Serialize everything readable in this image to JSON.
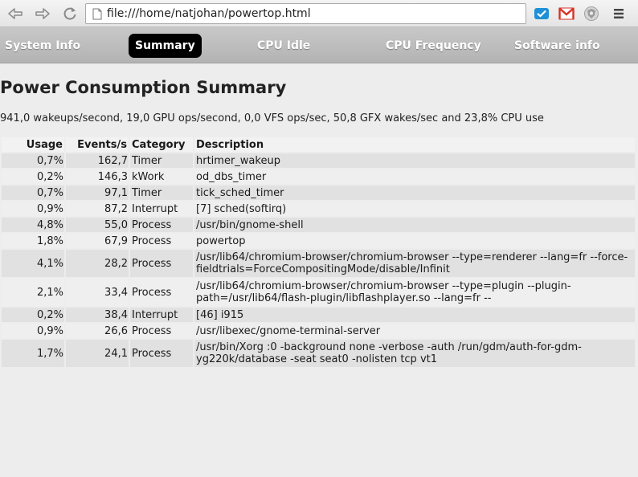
{
  "browser": {
    "url": "file:///home/natjohan/powertop.html",
    "icons": [
      "back-icon",
      "forward-icon",
      "reload-icon",
      "page-icon",
      "extension-check-icon",
      "gmail-icon",
      "extension-shield-icon",
      "menu-icon"
    ]
  },
  "tabs": [
    {
      "label": "System Info",
      "active": false
    },
    {
      "label": "Summary",
      "active": true
    },
    {
      "label": "CPU Idle",
      "active": false
    },
    {
      "label": "CPU Frequency",
      "active": false
    },
    {
      "label": "Software info",
      "active": false
    }
  ],
  "page": {
    "title": "Power Consumption Summary",
    "summary": "941,0 wakeups/second, 19,0 GPU ops/second, 0,0 VFS ops/sec, 50,8 GFX wakes/sec and 23,8% CPU use"
  },
  "table": {
    "headers": [
      "Usage",
      "Events/s",
      "Category",
      "Description"
    ],
    "rows": [
      {
        "usage": "0,7%",
        "events": "162,7",
        "category": "Timer",
        "description": "hrtimer_wakeup",
        "lines": [
          "hrtimer_wakeup"
        ]
      },
      {
        "usage": "0,2%",
        "events": "146,3",
        "category": "kWork",
        "description": "od_dbs_timer",
        "lines": [
          "od_dbs_timer"
        ]
      },
      {
        "usage": "0,7%",
        "events": "97,1",
        "category": "Timer",
        "description": "tick_sched_timer",
        "lines": [
          "tick_sched_timer"
        ]
      },
      {
        "usage": "0,9%",
        "events": "87,2",
        "category": "Interrupt",
        "description": "[7] sched(softirq)",
        "lines": [
          "[7] sched(softirq)"
        ]
      },
      {
        "usage": "4,8%",
        "events": "55,0",
        "category": "Process",
        "description": "/usr/bin/gnome-shell",
        "lines": [
          "/usr/bin/gnome-shell"
        ]
      },
      {
        "usage": "1,8%",
        "events": "67,9",
        "category": "Process",
        "description": "powertop",
        "lines": [
          "powertop"
        ]
      },
      {
        "usage": "4,1%",
        "events": "28,2",
        "category": "Process",
        "description": "/usr/lib64/chromium-browser/chromium-browser --type=renderer --lang=fr --force-fieldtrials=ForceCompositingMode/disable/Infinit",
        "lines": [
          "/usr/lib64/chromium-browser/chromium-browser --type=renderer --lang=fr --force-",
          "fieldtrials=ForceCompositingMode/disable/Infinit"
        ]
      },
      {
        "usage": "2,1%",
        "events": "33,4",
        "category": "Process",
        "description": "/usr/lib64/chromium-browser/chromium-browser --type=plugin --plugin-path=/usr/lib64/flash-plugin/libflashplayer.so --lang=fr --",
        "lines": [
          "/usr/lib64/chromium-browser/chromium-browser --type=plugin --plugin-",
          "path=/usr/lib64/flash-plugin/libflashplayer.so --lang=fr --"
        ]
      },
      {
        "usage": "0,2%",
        "events": "38,4",
        "category": "Interrupt",
        "description": "[46] i915",
        "lines": [
          "[46] i915"
        ]
      },
      {
        "usage": "0,9%",
        "events": "26,6",
        "category": "Process",
        "description": "/usr/libexec/gnome-terminal-server",
        "lines": [
          "/usr/libexec/gnome-terminal-server"
        ]
      },
      {
        "usage": "1,7%",
        "events": "24,1",
        "category": "Process",
        "description": "/usr/bin/Xorg :0 -background none -verbose -auth /run/gdm/auth-for-gdm-yg220k/database -seat seat0 -nolisten tcp vt1",
        "lines": [
          "/usr/bin/Xorg :0 -background none -verbose -auth /run/gdm/auth-for-gdm-",
          "yg220k/database -seat seat0 -nolisten tcp vt1"
        ]
      }
    ]
  },
  "colors": {
    "tab_active_bg": "#000000",
    "row_even": "#e1e1e1",
    "row_odd": "#efefef",
    "gmail_red": "#d93025",
    "ext_blue": "#1e90d6"
  }
}
